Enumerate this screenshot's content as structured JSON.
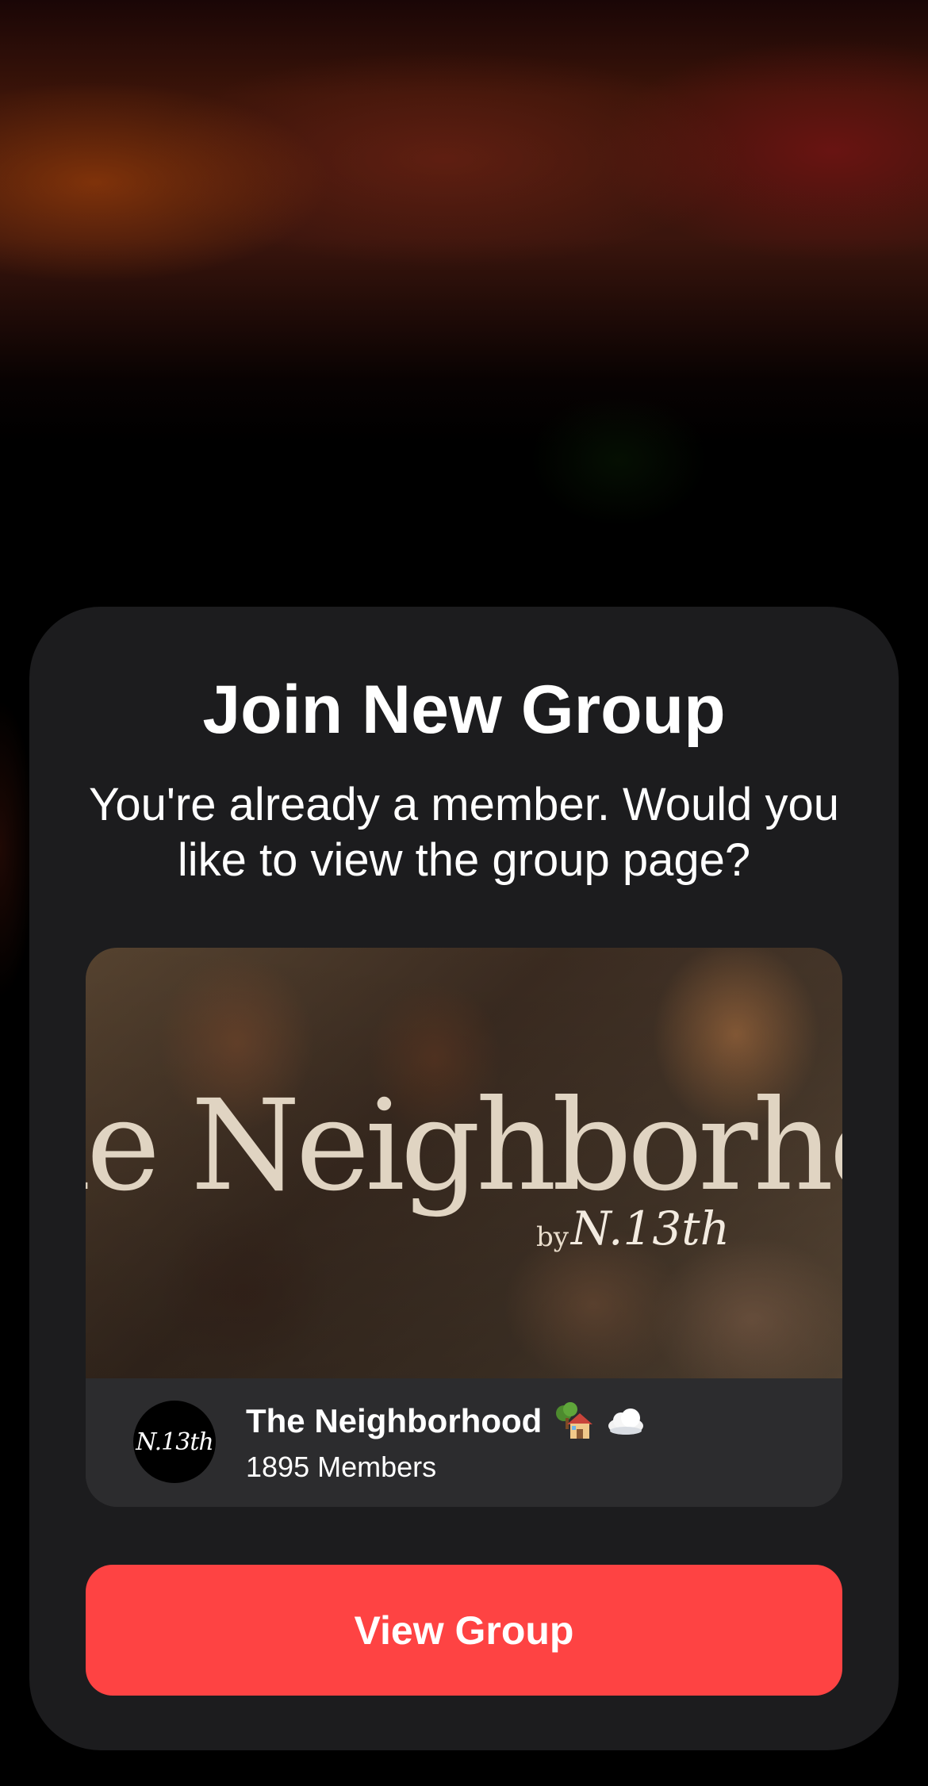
{
  "dialog": {
    "title": "Join New Group",
    "message": "You're already a member. Would you like to view the group page?"
  },
  "group": {
    "banner_title": "he Neighborhood",
    "banner_by": "by",
    "banner_logo": "N.13th",
    "avatar_text": "N.13th",
    "name": "The Neighborhood",
    "name_icons": [
      "house-with-tree-icon",
      "cloud-icon"
    ],
    "members": "1895 Members"
  },
  "actions": {
    "view_group_label": "View Group"
  },
  "colors": {
    "sheet_background": "#1c1c1e",
    "card_background": "#2c2c2e",
    "button_accent": "#fe4343",
    "text_primary": "#ffffff"
  }
}
